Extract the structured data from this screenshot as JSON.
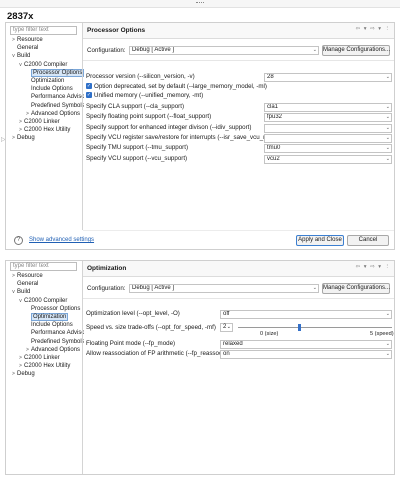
{
  "title": "2837x",
  "panel1": {
    "filter_placeholder": "type filter text",
    "tree": [
      {
        "label": "Resource",
        "indent": 1,
        "twisty": ">"
      },
      {
        "label": "General",
        "indent": 1,
        "twisty": ""
      },
      {
        "label": "Build",
        "indent": 1,
        "twisty": "v"
      },
      {
        "label": "C2000 Compiler",
        "indent": 2,
        "twisty": "v"
      },
      {
        "label": "Processor Options",
        "indent": 3,
        "twisty": ""
      },
      {
        "label": "Optimization",
        "indent": 3,
        "twisty": ""
      },
      {
        "label": "Include Options",
        "indent": 3,
        "twisty": ""
      },
      {
        "label": "Performance Advisor",
        "indent": 3,
        "twisty": ""
      },
      {
        "label": "Predefined Symbols",
        "indent": 3,
        "twisty": ""
      },
      {
        "label": "Advanced Options",
        "indent": 3,
        "twisty": ">"
      },
      {
        "label": "C2000 Linker",
        "indent": 2,
        "twisty": ">"
      },
      {
        "label": "C2000 Hex Utility",
        "indent": 2,
        "twisty": ">"
      },
      {
        "label": "Debug",
        "indent": 1,
        "twisty": ">"
      }
    ],
    "heading": "Processor Options",
    "header_icons": "⇦ ▾ ⇨ ▾ ⋮",
    "config_label": "Configuration:",
    "config_value": "Debug  [ Active ]",
    "manage_label": "Manage Configurations...",
    "processor_version_label": "Processor version (--silicon_version, -v)",
    "processor_version_value": "28",
    "check1_label": "Option deprecated, set by default (--large_memory_model, -ml)",
    "check2_label": "Unified memory (--unified_memory, -mt)",
    "fields": [
      {
        "label": "Specify CLA support (--cla_support)",
        "value": "cla1"
      },
      {
        "label": "Specify floating point support (--float_support)",
        "value": "fpu32"
      },
      {
        "label": "Specify support for enhanced integer divison (--idiv_support)",
        "value": ""
      },
      {
        "label": "Specify VCU register save/restore for interrupts (--isr_save_vcu_regs)",
        "value": ""
      },
      {
        "label": "Specify TMU support (--tmu_support)",
        "value": "tmu0"
      },
      {
        "label": "Specify VCU support (--vcu_support)",
        "value": "vcu2"
      }
    ],
    "show_advanced": "Show advanced settings",
    "apply_close": "Apply and Close",
    "cancel": "Cancel"
  },
  "panel2": {
    "filter_placeholder": "type filter text",
    "tree": [
      {
        "label": "Resource",
        "indent": 1,
        "twisty": ">"
      },
      {
        "label": "General",
        "indent": 1,
        "twisty": ""
      },
      {
        "label": "Build",
        "indent": 1,
        "twisty": "v"
      },
      {
        "label": "C2000 Compiler",
        "indent": 2,
        "twisty": "v"
      },
      {
        "label": "Processor Options",
        "indent": 3,
        "twisty": ""
      },
      {
        "label": "Optimization",
        "indent": 3,
        "twisty": ""
      },
      {
        "label": "Include Options",
        "indent": 3,
        "twisty": ""
      },
      {
        "label": "Performance Advisor",
        "indent": 3,
        "twisty": ""
      },
      {
        "label": "Predefined Symbols",
        "indent": 3,
        "twisty": ""
      },
      {
        "label": "Advanced Options",
        "indent": 3,
        "twisty": ">"
      },
      {
        "label": "C2000 Linker",
        "indent": 2,
        "twisty": ">"
      },
      {
        "label": "C2000 Hex Utility",
        "indent": 2,
        "twisty": ">"
      },
      {
        "label": "Debug",
        "indent": 1,
        "twisty": ">"
      }
    ],
    "heading": "Optimization",
    "header_icons": "⇦ ▾ ⇨ ▾ ⋮",
    "config_label": "Configuration:",
    "config_value": "Debug  [ Active ]",
    "manage_label": "Manage Configurations...",
    "opt_level_label": "Optimization level (--opt_level, -O)",
    "opt_level_value": "off",
    "speed_label": "Speed vs. size trade-offs (--opt_for_speed, -mf)",
    "speed_value": "2",
    "speed_fraction": 0.4,
    "speed_min_label": "0 (size)",
    "speed_max_label": "5 (speed)",
    "fp_mode_label": "Floating Point mode (--fp_mode)",
    "fp_mode_value": "relaxed",
    "fp_reassoc_label": "Allow reassociation of FP arithmetic (--fp_reassoc)",
    "fp_reassoc_value": "on"
  }
}
